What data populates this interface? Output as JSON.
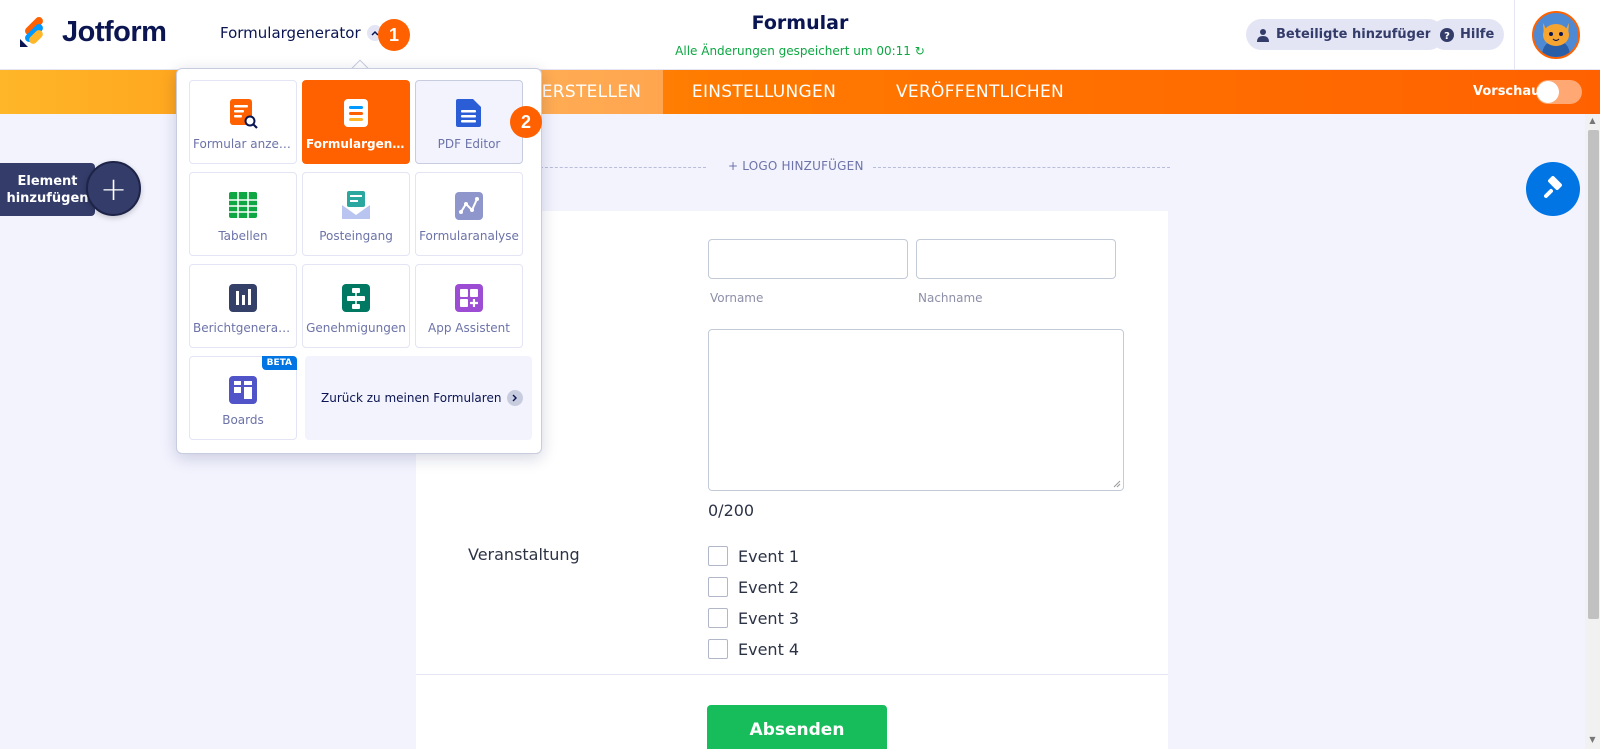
{
  "app": {
    "brand": "Jotform",
    "builder_select": "Formulargenerator",
    "form_title": "Formular",
    "saved_status": "Alle Änderungen gespeichert um 00:11",
    "add_collaborators": "Beteiligte hinzufügen",
    "help": "Hilfe"
  },
  "step_badges": [
    "1",
    "2"
  ],
  "nav": {
    "tabs": [
      {
        "label": "ERSTELLEN",
        "active": true
      },
      {
        "label": "EINSTELLUNGEN",
        "active": false
      },
      {
        "label": "VERÖFFENTLICHEN",
        "active": false
      }
    ],
    "preview_label": "Vorschau",
    "preview_on": false
  },
  "sidebar": {
    "add_element_line1": "Element",
    "add_element_line2": "hinzufügen",
    "add_plus": "+"
  },
  "menu": {
    "tiles": [
      {
        "label": "Formular anzeigen",
        "icon": "form-view-icon"
      },
      {
        "label": "Formulargenerator",
        "icon": "form-builder-icon",
        "active": true
      },
      {
        "label": "PDF Editor",
        "icon": "pdf-editor-icon",
        "hovered": true
      },
      {
        "label": "Tabellen",
        "icon": "tables-icon"
      },
      {
        "label": "Posteingang",
        "icon": "inbox-icon"
      },
      {
        "label": "Formularanalyse",
        "icon": "analytics-icon"
      },
      {
        "label": "Berichtgenerator",
        "icon": "report-builder-icon"
      },
      {
        "label": "Genehmigungen",
        "icon": "approvals-icon"
      },
      {
        "label": "App Assistent",
        "icon": "app-builder-icon"
      },
      {
        "label": "Boards",
        "icon": "boards-icon",
        "badge": "BETA"
      }
    ],
    "back_link": "Zurück zu meinen Formularen"
  },
  "form": {
    "add_logo": "+ LOGO HINZUFÜGEN",
    "first_name_sublabel": "Vorname",
    "last_name_sublabel": "Nachname",
    "textarea_count": "0/200",
    "event_label": "Veranstaltung",
    "events": [
      "Event 1",
      "Event 2",
      "Event 3",
      "Event 4"
    ],
    "submit": "Absenden"
  },
  "colors": {
    "brand_orange": "#ff6100",
    "navy": "#0a1551",
    "submit_green": "#18bd5b",
    "blue": "#0075e3"
  }
}
